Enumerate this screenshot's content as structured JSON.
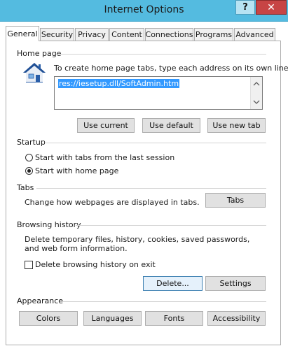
{
  "window": {
    "title": "Internet Options",
    "help_label": "?",
    "close_label": "✕"
  },
  "tabs": [
    {
      "label": "General",
      "active": true
    },
    {
      "label": "Security"
    },
    {
      "label": "Privacy"
    },
    {
      "label": "Content"
    },
    {
      "label": "Connections"
    },
    {
      "label": "Programs"
    },
    {
      "label": "Advanced"
    }
  ],
  "home_page": {
    "group_label": "Home page",
    "icon": "house-icon",
    "instruction": "To create home page tabs, type each address on its own line.",
    "address_value": "res://iesetup.dll/SoftAdmin.htm",
    "buttons": {
      "use_current": "Use current",
      "use_default": "Use default",
      "use_new_tab": "Use new tab"
    }
  },
  "startup": {
    "group_label": "Startup",
    "option_last_session": "Start with tabs from the last session",
    "option_home_page": "Start with home page",
    "selected": "home_page"
  },
  "tabs_group": {
    "group_label": "Tabs",
    "description": "Change how webpages are displayed in tabs.",
    "button": "Tabs"
  },
  "browsing_history": {
    "group_label": "Browsing history",
    "description": "Delete temporary files, history, cookies, saved passwords, and web form information.",
    "checkbox_label": "Delete browsing history on exit",
    "checkbox_checked": false,
    "delete_button": "Delete...",
    "settings_button": "Settings"
  },
  "appearance": {
    "group_label": "Appearance",
    "buttons": {
      "colors": "Colors",
      "languages": "Languages",
      "fonts": "Fonts",
      "accessibility": "Accessibility"
    }
  },
  "colors": {
    "titlebar": "#54bbe0",
    "close": "#c74444",
    "selection": "#3399ff",
    "house_roof": "#2a5ea8"
  }
}
